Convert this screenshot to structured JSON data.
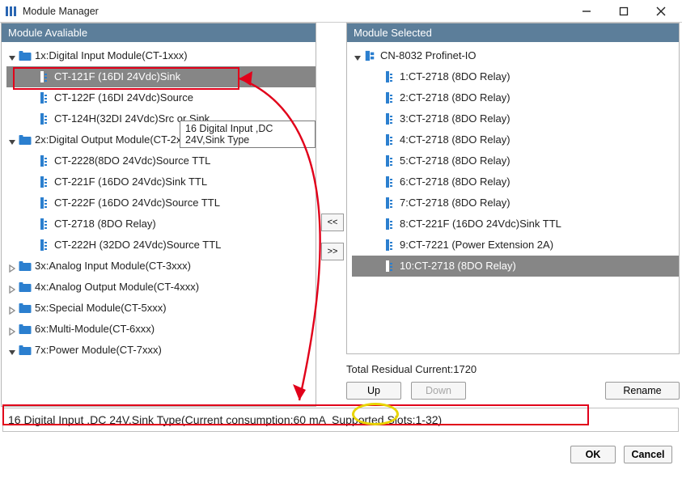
{
  "window": {
    "title": "Module Manager"
  },
  "left": {
    "header": "Module Avaliable",
    "groups": [
      {
        "open": true,
        "label": "1x:Digital Input Module(CT-1xxx)",
        "items": [
          {
            "label": "CT-121F (16DI 24Vdc)Sink",
            "selected": true
          },
          {
            "label": "CT-122F (16DI 24Vdc)Source"
          },
          {
            "label": "CT-124H(32DI 24Vdc)Src or Sink"
          }
        ]
      },
      {
        "open": true,
        "label": "2x:Digital Output Module(CT-2xxx)",
        "items": [
          {
            "label": "CT-2228(8DO 24Vdc)Source TTL"
          },
          {
            "label": "CT-221F (16DO 24Vdc)Sink TTL"
          },
          {
            "label": "CT-222F (16DO 24Vdc)Source TTL"
          },
          {
            "label": "CT-2718 (8DO Relay)"
          },
          {
            "label": "CT-222H (32DO 24Vdc)Source TTL"
          }
        ]
      },
      {
        "open": false,
        "label": "3x:Analog Input Module(CT-3xxx)"
      },
      {
        "open": false,
        "label": "4x:Analog Output Module(CT-4xxx)"
      },
      {
        "open": false,
        "label": "5x:Special Module(CT-5xxx)"
      },
      {
        "open": false,
        "label": "6x:Multi-Module(CT-6xxx)"
      },
      {
        "open": true,
        "label": "7x:Power Module(CT-7xxx)"
      }
    ],
    "tooltip": "16 Digital Input ,DC 24V,Sink Type"
  },
  "right": {
    "header": "Module Selected",
    "root": "CN-8032 Profinet-IO",
    "items": [
      {
        "label": "1:CT-2718 (8DO Relay)"
      },
      {
        "label": "2:CT-2718 (8DO Relay)"
      },
      {
        "label": "3:CT-2718 (8DO Relay)"
      },
      {
        "label": "4:CT-2718 (8DO Relay)"
      },
      {
        "label": "5:CT-2718 (8DO Relay)"
      },
      {
        "label": "6:CT-2718 (8DO Relay)"
      },
      {
        "label": "7:CT-2718 (8DO Relay)"
      },
      {
        "label": "8:CT-221F (16DO 24Vdc)Sink TTL"
      },
      {
        "label": "9:CT-7221 (Power Extension 2A)"
      },
      {
        "label": "10:CT-2718 (8DO Relay)",
        "selected": true
      }
    ]
  },
  "mid": {
    "left": "<<",
    "right": ">>"
  },
  "residual": {
    "label": "Total Residual Current:",
    "value": "1720"
  },
  "buttons": {
    "up": "Up",
    "down": "Down",
    "rename": "Rename",
    "ok": "OK",
    "cancel": "Cancel"
  },
  "description": "16 Digital Input ,DC 24V,Sink Type(Current consumption:60 mA  Supported Slots:1-32)"
}
